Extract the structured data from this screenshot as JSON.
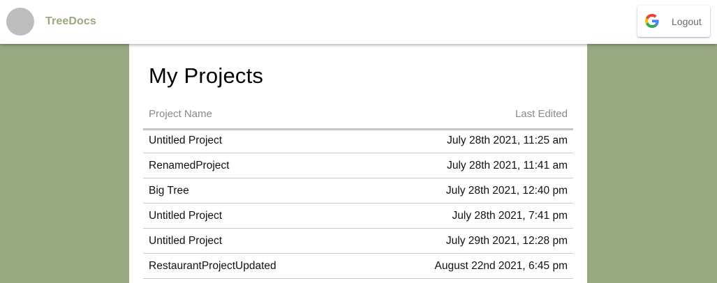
{
  "header": {
    "brand": "TreeDocs",
    "logout_label": "Logout"
  },
  "icons": {
    "avatar": "avatar-placeholder",
    "logout": "google-g-icon"
  },
  "colors": {
    "background": "#98a981",
    "brand": "#98a981",
    "avatar": "#bdbdbd"
  },
  "main": {
    "title": "My Projects",
    "columns": {
      "name": "Project Name",
      "edited": "Last Edited"
    },
    "projects": [
      {
        "name": "Untitled Project",
        "edited": "July 28th 2021, 11:25 am"
      },
      {
        "name": "RenamedProject",
        "edited": "July 28th 2021, 11:41 am"
      },
      {
        "name": "Big Tree",
        "edited": "July 28th 2021, 12:40 pm"
      },
      {
        "name": "Untitled Project",
        "edited": "July 28th 2021, 7:41 pm"
      },
      {
        "name": "Untitled Project",
        "edited": "July 29th 2021, 12:28 pm"
      },
      {
        "name": "RestaurantProjectUpdated",
        "edited": "August 22nd 2021, 6:45 pm"
      }
    ]
  }
}
